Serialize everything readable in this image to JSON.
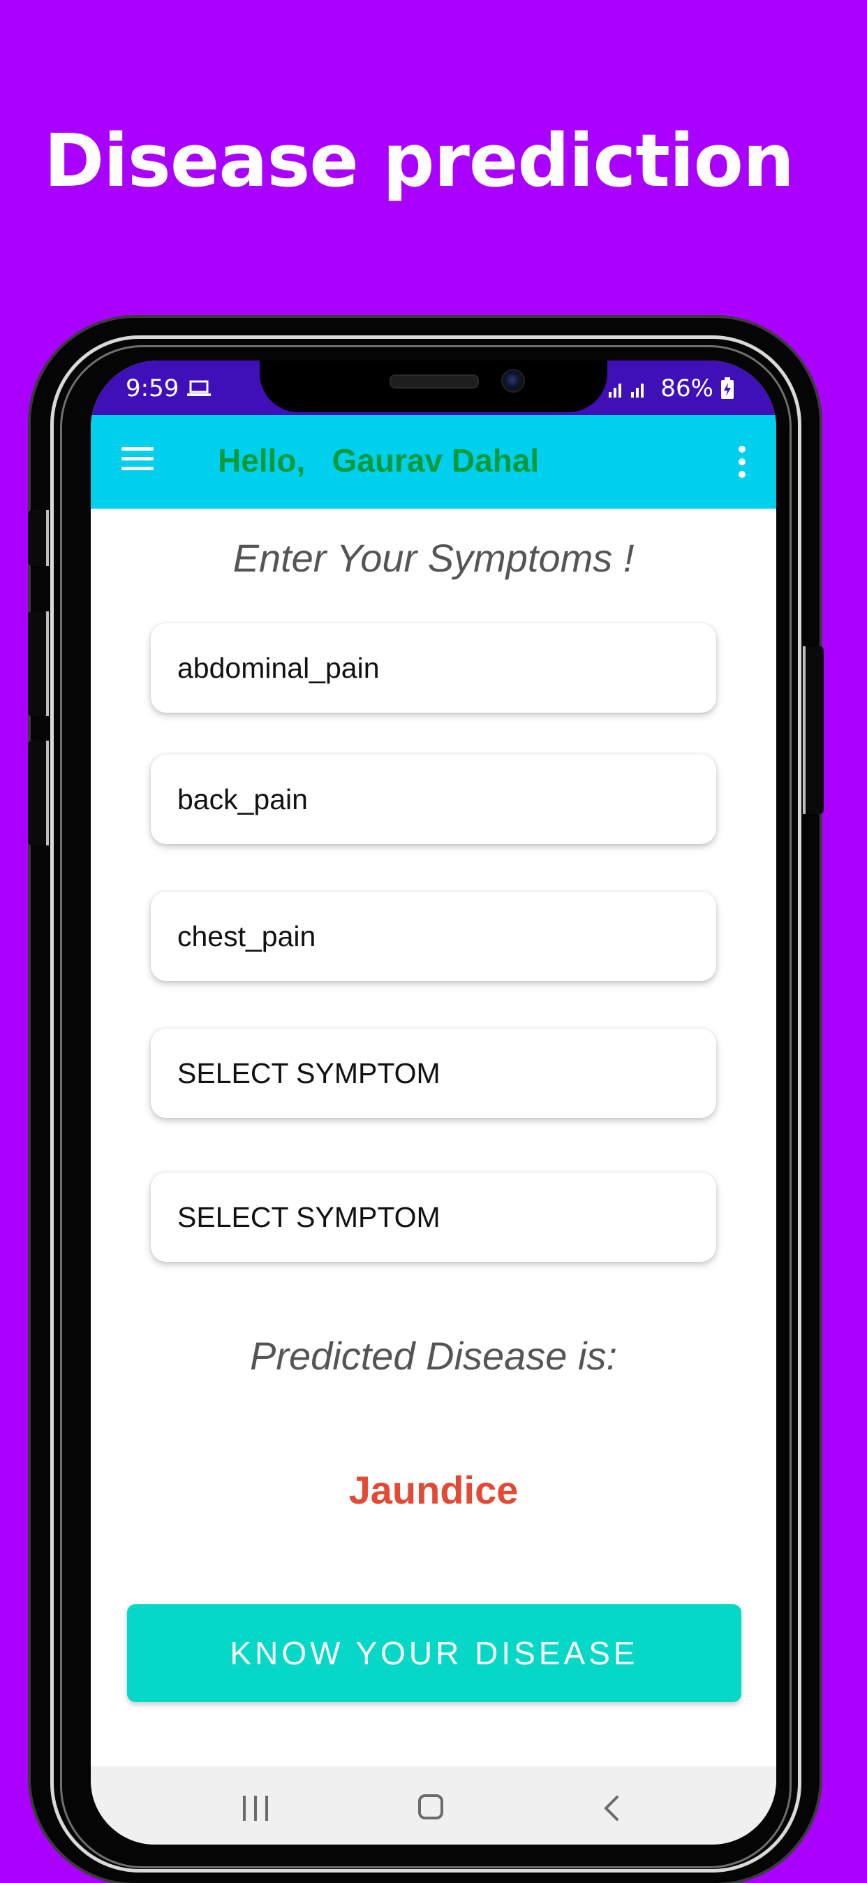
{
  "promo": {
    "title": "Disease prediction"
  },
  "status_bar": {
    "time": "9:59",
    "battery": "86%",
    "icons": [
      "laptop-icon",
      "signal-icon",
      "battery-charging-icon"
    ]
  },
  "app_bar": {
    "greeting": "Hello,   Gaurav Dahal",
    "menu_icon": "hamburger-menu-icon",
    "overflow_icon": "more-vert-icon"
  },
  "main": {
    "heading": "Enter Your Symptoms !",
    "symptoms": [
      {
        "value": "abdominal_pain"
      },
      {
        "value": "back_pain"
      },
      {
        "value": "chest_pain"
      },
      {
        "value": "SELECT SYMPTOM"
      },
      {
        "value": "SELECT SYMPTOM"
      }
    ],
    "predicted_label": "Predicted Disease is:",
    "predicted_value": "Jaundice",
    "action_button": "KNOW YOUR DISEASE"
  },
  "nav_bar": {
    "icons": [
      "recent-apps-icon",
      "home-icon",
      "back-icon"
    ]
  },
  "colors": {
    "background": "#aa00ff",
    "status_bar": "#3f0fb8",
    "app_bar": "#00d0ee",
    "greeting": "#0a9a3a",
    "predicted_value": "#e24a34",
    "button": "#05d8c6"
  }
}
